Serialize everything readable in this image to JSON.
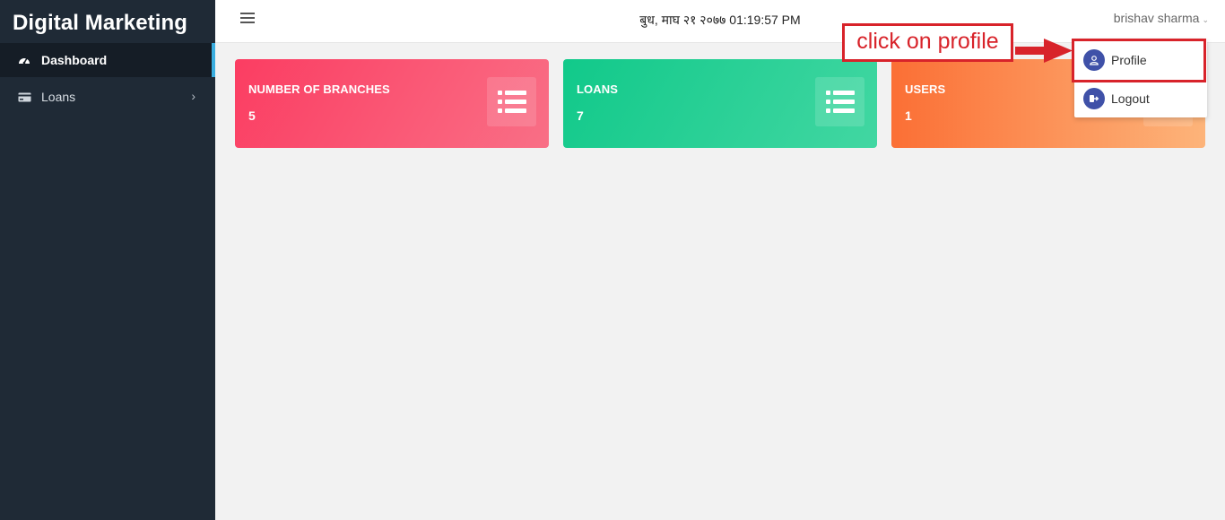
{
  "sidebar": {
    "brand": "Digital Marketing",
    "items": [
      {
        "label": "Dashboard",
        "icon": "dashboard-icon",
        "active": true
      },
      {
        "label": "Loans",
        "icon": "wallet-icon",
        "has_submenu": true
      }
    ]
  },
  "topbar": {
    "datetime": "बुध, माघ २१ २०७७ 01:19:57 PM",
    "user_name": "brishav sharma"
  },
  "cards": [
    {
      "title": "NUMBER OF BRANCHES",
      "value": "5",
      "icon": "list-icon",
      "color": "#fb3d62"
    },
    {
      "title": "LOANS",
      "value": "7",
      "icon": "list-icon",
      "color": "#11c98a"
    },
    {
      "title": "USERS",
      "value": "1",
      "icon": "list-icon",
      "color": "#fb6f35"
    }
  ],
  "user_menu": {
    "items": [
      {
        "label": "Profile",
        "icon": "user-icon"
      },
      {
        "label": "Logout",
        "icon": "logout-icon"
      }
    ]
  },
  "annotation": {
    "text": "click on profile",
    "color": "#d8232a"
  }
}
